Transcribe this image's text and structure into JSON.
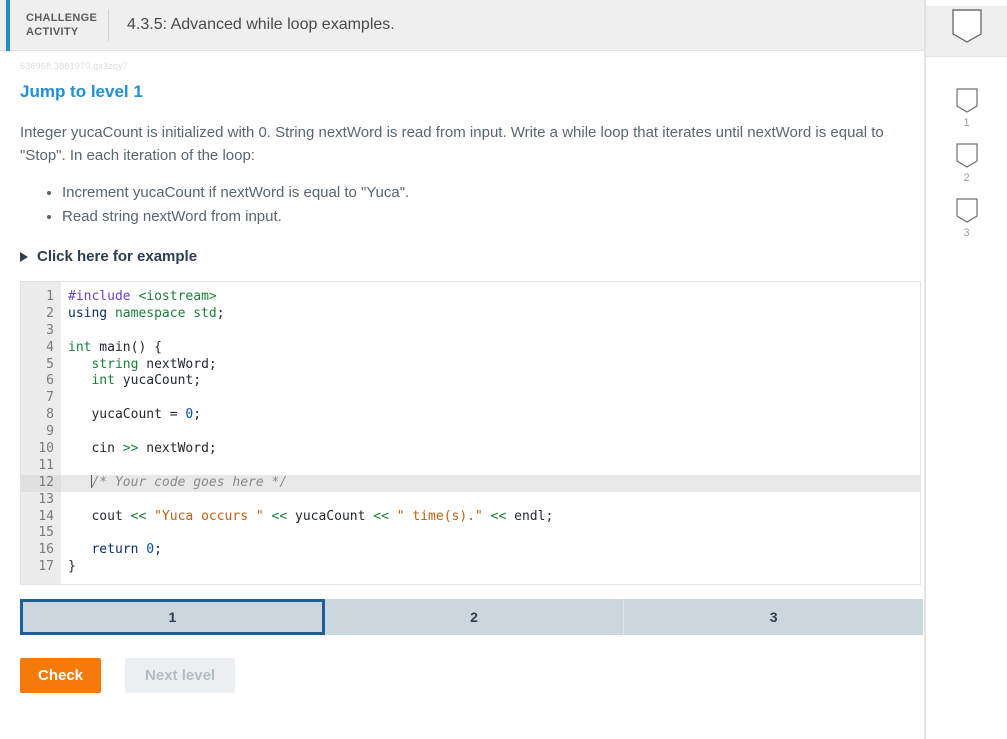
{
  "header": {
    "kicker_line1": "CHALLENGE",
    "kicker_line2": "ACTIVITY",
    "title": "4.3.5: Advanced while loop examples.",
    "accent_color": "#1e90d2"
  },
  "body": {
    "activity_id": "536968.3881970.qx3zqy7",
    "jump_label": "Jump to level 1",
    "prompt": "Integer yucaCount is initialized with 0. String nextWord is read from input. Write a while loop that iterates until nextWord is equal to \"Stop\". In each iteration of the loop:",
    "steps": [
      "Increment yucaCount if nextWord is equal to \"Yuca\".",
      "Read string nextWord from input."
    ],
    "example_toggle": "Click here for example"
  },
  "editor": {
    "highlight_line": 12,
    "caret_line": 12,
    "lines": [
      {
        "n": "1",
        "tokens": [
          {
            "t": "#include ",
            "c": "k-pre"
          },
          {
            "t": "<iostream>",
            "c": "k-hdr"
          }
        ]
      },
      {
        "n": "2",
        "tokens": [
          {
            "t": "using ",
            "c": "k-kw"
          },
          {
            "t": "namespace std",
            "c": "k-type"
          },
          {
            "t": ";",
            "c": "k-id"
          }
        ]
      },
      {
        "n": "3",
        "tokens": []
      },
      {
        "n": "4",
        "tokens": [
          {
            "t": "int",
            "c": "k-type"
          },
          {
            "t": " main() {",
            "c": "k-id"
          }
        ]
      },
      {
        "n": "5",
        "tokens": [
          {
            "t": "   ",
            "c": "k-id"
          },
          {
            "t": "string",
            "c": "k-type"
          },
          {
            "t": " nextWord;",
            "c": "k-id"
          }
        ]
      },
      {
        "n": "6",
        "tokens": [
          {
            "t": "   ",
            "c": "k-id"
          },
          {
            "t": "int",
            "c": "k-type"
          },
          {
            "t": " yucaCount;",
            "c": "k-id"
          }
        ]
      },
      {
        "n": "7",
        "tokens": []
      },
      {
        "n": "8",
        "tokens": [
          {
            "t": "   yucaCount = ",
            "c": "k-id"
          },
          {
            "t": "0",
            "c": "k-num"
          },
          {
            "t": ";",
            "c": "k-id"
          }
        ]
      },
      {
        "n": "9",
        "tokens": []
      },
      {
        "n": "10",
        "tokens": [
          {
            "t": "   cin ",
            "c": "k-id"
          },
          {
            "t": ">>",
            "c": "k-op"
          },
          {
            "t": " nextWord;",
            "c": "k-id"
          }
        ]
      },
      {
        "n": "11",
        "tokens": []
      },
      {
        "n": "12",
        "tokens": [
          {
            "t": "   ",
            "c": "k-id"
          },
          {
            "t": "/* Your code goes here */",
            "c": "k-cmt"
          }
        ]
      },
      {
        "n": "13",
        "tokens": []
      },
      {
        "n": "14",
        "tokens": [
          {
            "t": "   cout ",
            "c": "k-id"
          },
          {
            "t": "<<",
            "c": "k-op"
          },
          {
            "t": " ",
            "c": "k-id"
          },
          {
            "t": "\"Yuca occurs \"",
            "c": "k-str"
          },
          {
            "t": " ",
            "c": "k-id"
          },
          {
            "t": "<<",
            "c": "k-op"
          },
          {
            "t": " yucaCount ",
            "c": "k-id"
          },
          {
            "t": "<<",
            "c": "k-op"
          },
          {
            "t": " ",
            "c": "k-id"
          },
          {
            "t": "\" time(s).\"",
            "c": "k-str"
          },
          {
            "t": " ",
            "c": "k-id"
          },
          {
            "t": "<<",
            "c": "k-op"
          },
          {
            "t": " endl;",
            "c": "k-id"
          }
        ]
      },
      {
        "n": "15",
        "tokens": []
      },
      {
        "n": "16",
        "tokens": [
          {
            "t": "   ",
            "c": "k-id"
          },
          {
            "t": "return",
            "c": "k-kw"
          },
          {
            "t": " ",
            "c": "k-id"
          },
          {
            "t": "0",
            "c": "k-num"
          },
          {
            "t": ";",
            "c": "k-id"
          }
        ]
      },
      {
        "n": "17",
        "tokens": [
          {
            "t": "}",
            "c": "k-id"
          }
        ]
      }
    ]
  },
  "tabs": {
    "active_index": 0,
    "items": [
      {
        "label": "1"
      },
      {
        "label": "2"
      },
      {
        "label": "3"
      }
    ]
  },
  "actions": {
    "check_label": "Check",
    "next_label": "Next level",
    "check_color": "#f47b0a"
  },
  "rail": {
    "header_icon": "pennant-icon",
    "items": [
      {
        "icon": "pennant-icon",
        "number": "1"
      },
      {
        "icon": "pennant-icon",
        "number": "2"
      },
      {
        "icon": "pennant-icon",
        "number": "3"
      }
    ]
  }
}
